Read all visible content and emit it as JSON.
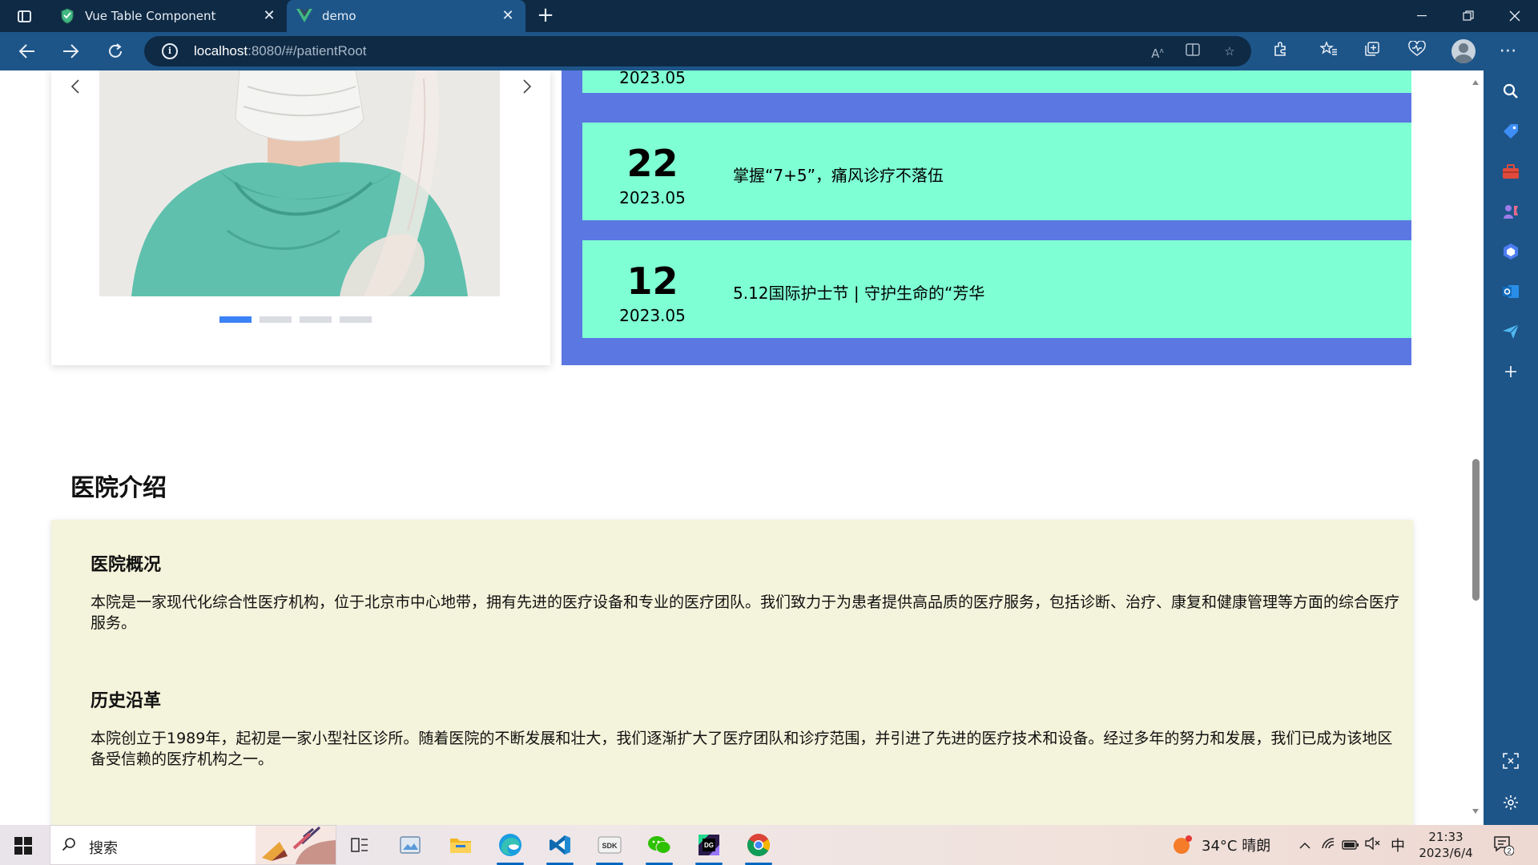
{
  "browser": {
    "tabs": [
      {
        "title": "Vue Table Component",
        "active": false
      },
      {
        "title": "demo",
        "active": true
      }
    ],
    "url_host": "localhost",
    "url_rest": ":8080/#/patientRoot"
  },
  "news": {
    "items": [
      {
        "day": "",
        "ym": "2023.05",
        "title": ""
      },
      {
        "day": "22",
        "ym": "2023.05",
        "title": "掌握“7+5”，痛风诊疗不落伍"
      },
      {
        "day": "12",
        "ym": "2023.05",
        "title": "5.12国际护士节 | 守护生命的“芳华"
      }
    ]
  },
  "carousel": {
    "slide_count": 4,
    "active_index": 0
  },
  "intro": {
    "heading": "医院介绍",
    "sections": [
      {
        "title": "医院概况",
        "body": "本院是一家现代化综合性医疗机构，位于北京市中心地带，拥有先进的医疗设备和专业的医疗团队。我们致力于为患者提供高品质的医疗服务，包括诊断、治疗、康复和健康管理等方面的综合医疗服务。"
      },
      {
        "title": "历史沿革",
        "body": "本院创立于1989年，起初是一家小型社区诊所。随着医院的不断发展和壮大，我们逐渐扩大了医疗团队和诊疗范围，并引进了先进的医疗技术和设备。经过多年的努力和发展，我们已成为该地区备受信赖的医疗机构之一。"
      }
    ]
  },
  "taskbar": {
    "search_placeholder": "搜索",
    "weather": "34°C  晴朗",
    "ime": "中",
    "time": "21:33",
    "date": "2023/6/4",
    "notifications": "2"
  },
  "colors": {
    "news_panel": "#5b77e2",
    "news_item": "#7fffd4",
    "intro_card": "#f4f3db",
    "dot_active": "#3b82f6"
  }
}
